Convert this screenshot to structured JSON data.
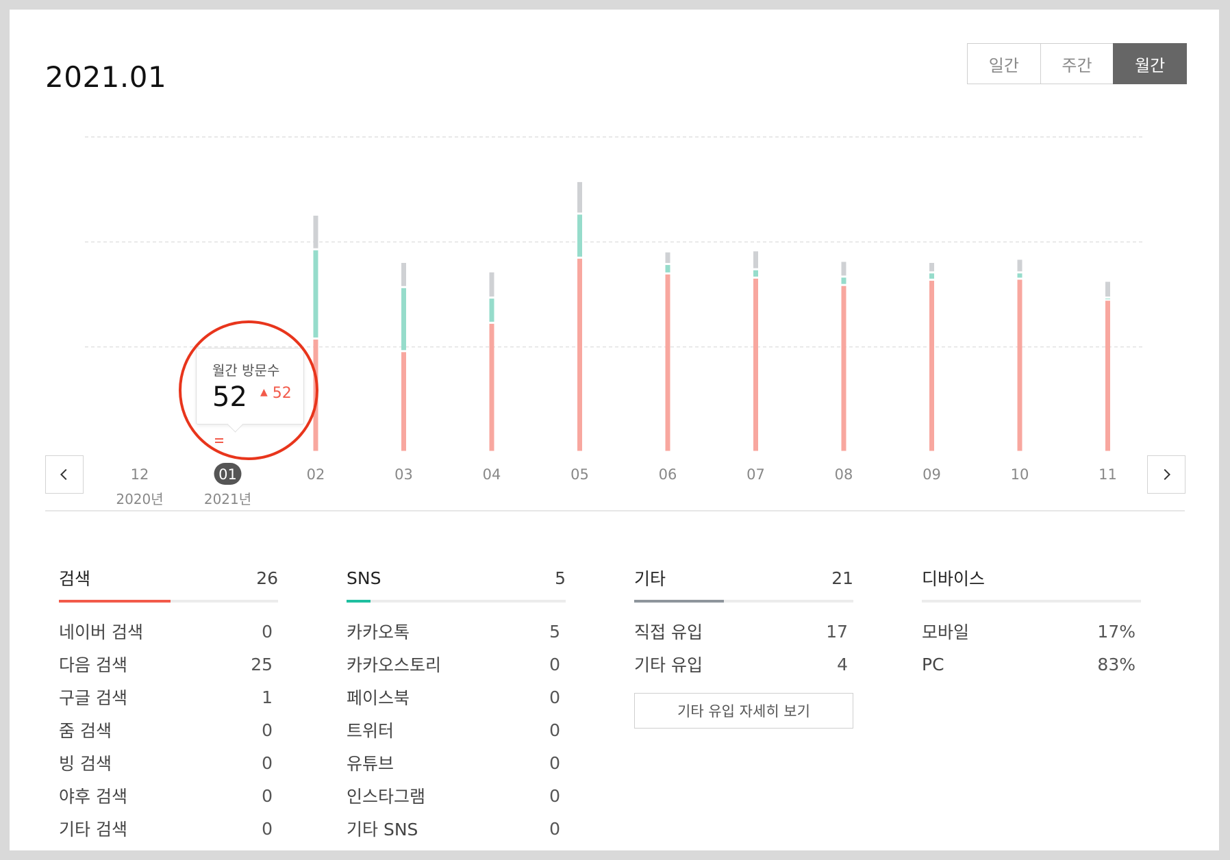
{
  "period": {
    "title": "2021.01"
  },
  "view_toggle": [
    {
      "label": "일간",
      "active": false
    },
    {
      "label": "주간",
      "active": false
    },
    {
      "label": "월간",
      "active": true
    }
  ],
  "colors": {
    "search": "#f8a79f",
    "sns": "#96dccb",
    "etc": "#cfd1d4",
    "accent_red": "#f25a4a",
    "highlight_ring": "#e8351c",
    "search_bar": "#f25a4a",
    "sns_bar": "#1fbfa0",
    "etc_bar": "#8e959c"
  },
  "chart_data": {
    "type": "bar",
    "stacked": true,
    "categories": [
      "12",
      "01",
      "02",
      "03",
      "04",
      "05",
      "06",
      "07",
      "08",
      "09",
      "10",
      "11"
    ],
    "year_labels": {
      "0": "2020년",
      "1": "2021년"
    },
    "selected_index": 1,
    "ylim": [
      0,
      300
    ],
    "grid": true,
    "series": [
      {
        "key": "search",
        "values": [
          0,
          0,
          108,
          96,
          123,
          185,
          170,
          166,
          159,
          164,
          165,
          145
        ]
      },
      {
        "key": "sns",
        "values": [
          0,
          0,
          85,
          61,
          24,
          42,
          9,
          8,
          8,
          7,
          6,
          2
        ]
      },
      {
        "key": "etc",
        "values": [
          0,
          0,
          33,
          24,
          25,
          31,
          12,
          18,
          15,
          10,
          13,
          16
        ]
      }
    ]
  },
  "tooltip": {
    "label": "월간 방문수",
    "value": "52",
    "change": "52"
  },
  "stats": {
    "search": {
      "name": "검색",
      "total": "26",
      "ratio": 0.51,
      "items": [
        {
          "label": "네이버 검색",
          "value": "0"
        },
        {
          "label": "다음 검색",
          "value": "25"
        },
        {
          "label": "구글 검색",
          "value": "1"
        },
        {
          "label": "줌 검색",
          "value": "0"
        },
        {
          "label": "빙 검색",
          "value": "0"
        },
        {
          "label": "야후 검색",
          "value": "0"
        },
        {
          "label": "기타 검색",
          "value": "0"
        }
      ]
    },
    "sns": {
      "name": "SNS",
      "total": "5",
      "ratio": 0.11,
      "items": [
        {
          "label": "카카오톡",
          "value": "5"
        },
        {
          "label": "카카오스토리",
          "value": "0"
        },
        {
          "label": "페이스북",
          "value": "0"
        },
        {
          "label": "트위터",
          "value": "0"
        },
        {
          "label": "유튜브",
          "value": "0"
        },
        {
          "label": "인스타그램",
          "value": "0"
        },
        {
          "label": "기타 SNS",
          "value": "0"
        }
      ]
    },
    "etc": {
      "name": "기타",
      "total": "21",
      "ratio": 0.41,
      "items": [
        {
          "label": "직접 유입",
          "value": "17"
        },
        {
          "label": "기타 유입",
          "value": "4"
        }
      ],
      "more_label": "기타 유입 자세히 보기"
    },
    "device": {
      "name": "디바이스",
      "items": [
        {
          "label": "모바일",
          "value": "17%"
        },
        {
          "label": "PC",
          "value": "83%"
        }
      ]
    }
  }
}
